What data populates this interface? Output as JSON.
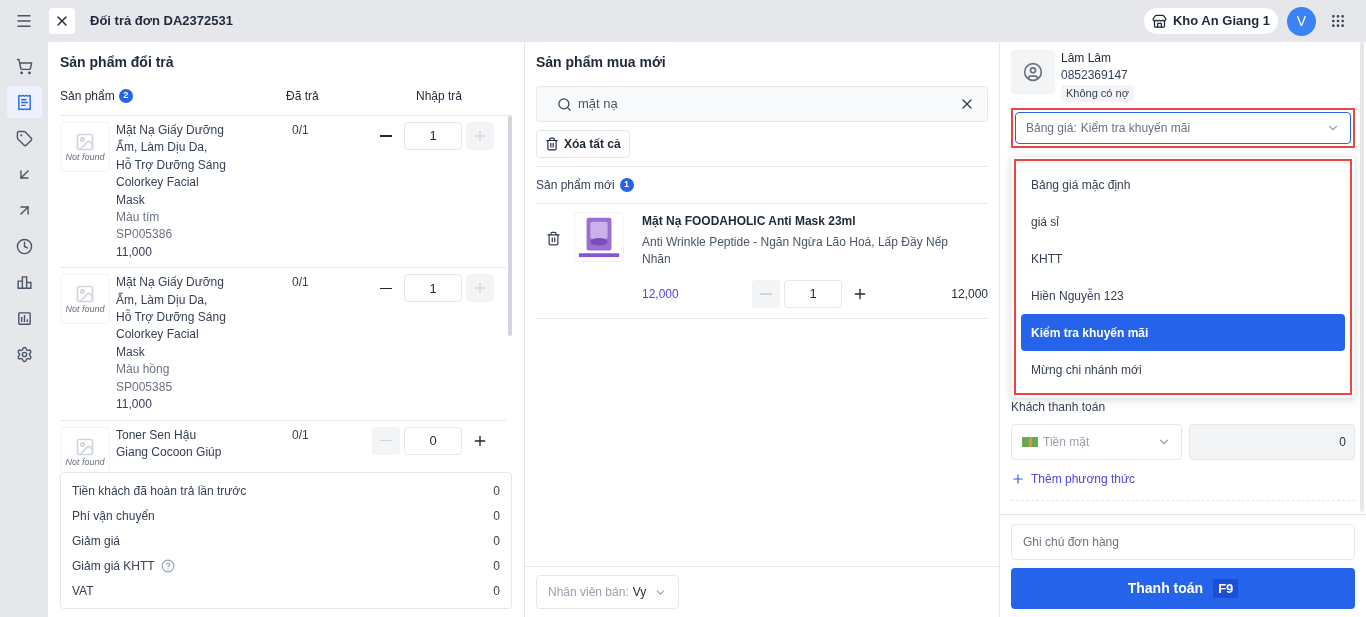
{
  "header": {
    "title": "Đối trả đơn DA2372531",
    "store": "Kho An Giang 1",
    "avatar": "V"
  },
  "sidebar": {
    "items": [
      {
        "selected": false
      },
      {
        "selected": true
      },
      {
        "selected": false
      },
      {
        "selected": false
      },
      {
        "selected": false
      },
      {
        "selected": false
      },
      {
        "selected": false
      },
      {
        "selected": false
      },
      {
        "selected": false
      }
    ]
  },
  "returns": {
    "title": "Sản phẩm đổi trả",
    "columns": [
      "Sản phẩm",
      "Đã trả",
      "Nhập trả"
    ],
    "count": "2",
    "rows": [
      {
        "name": "Mặt Nạ Giấy Dưỡng Ẩm, Làm Dịu Da, Hỗ Trợ Dưỡng Sáng Colorkey Facial Mask",
        "variant": "Màu tím",
        "sku": "SP005386",
        "price": "11,000",
        "returned": "0/1",
        "qty": "1",
        "can_decrease": true,
        "can_increase": false,
        "image_text": "Not found"
      },
      {
        "name": "Mặt Nạ Giấy Dưỡng Ẩm, Làm Dịu Da, Hỗ Trợ Dưỡng Sáng Colorkey Facial Mask",
        "variant": "Màu hồng",
        "sku": "SP005385",
        "price": "11,000",
        "returned": "0/1",
        "qty": "1",
        "can_decrease": true,
        "can_increase": false,
        "image_text": "Not found"
      },
      {
        "name": "Toner Sen Hậu Giang Cocoon Giúp",
        "returned": "0/1",
        "qty": "0",
        "can_decrease": false,
        "can_increase": true,
        "image_text": "Not found"
      }
    ],
    "summary": [
      {
        "label": "Tiền khách đã hoàn trả lần trước",
        "value": "0",
        "help": false
      },
      {
        "label": "Phí vận chuyển",
        "value": "0",
        "help": false
      },
      {
        "label": "Giảm giá",
        "value": "0",
        "help": false
      },
      {
        "label": "Giảm giá KHTT",
        "value": "0",
        "help": true
      },
      {
        "label": "VAT",
        "value": "0",
        "help": false
      }
    ]
  },
  "new_products": {
    "title": "Sản phẩm mua mới",
    "search": "mặt nạ",
    "clear_all": "Xóa tất cả",
    "section": "Sản phẩm mới",
    "count": "1",
    "items": [
      {
        "name": "Mặt Nạ FOODAHOLIC Anti Mask 23ml",
        "description": "Anti Wrinkle Peptide - Ngăn Ngừa Lão Hoá, Lấp Đầy Nếp Nhăn",
        "price": "12,000",
        "qty": "1",
        "total": "12,000",
        "can_decrease": false,
        "can_increase": true
      }
    ],
    "seller": {
      "label": "Nhân viên bán:",
      "value": "Vy"
    }
  },
  "customer": {
    "name": "Lâm Lâm",
    "phone": "0852369147",
    "tag": "Không có nợ"
  },
  "price_list": {
    "label": "Bảng giá:",
    "value": "Kiểm tra khuyến mãi",
    "highlighted": true,
    "options": [
      {
        "label": "Bảng giá mặc định",
        "selected": false
      },
      {
        "label": "giá sỉ",
        "selected": false
      },
      {
        "label": "KHTT",
        "selected": false
      },
      {
        "label": "Hiền Nguyễn 123",
        "selected": false
      },
      {
        "label": "Kiểm tra khuyến mãi",
        "selected": true
      },
      {
        "label": "Mừng chi nhánh mới",
        "selected": false
      }
    ]
  },
  "payment": {
    "title": "Khách thanh toán",
    "method": "Tiền mặt",
    "amount": "0",
    "add": "Thêm phương thức"
  },
  "note": {
    "placeholder": "Ghi chú đơn hàng"
  },
  "checkout": {
    "label": "Thanh toán",
    "key": "F9"
  }
}
